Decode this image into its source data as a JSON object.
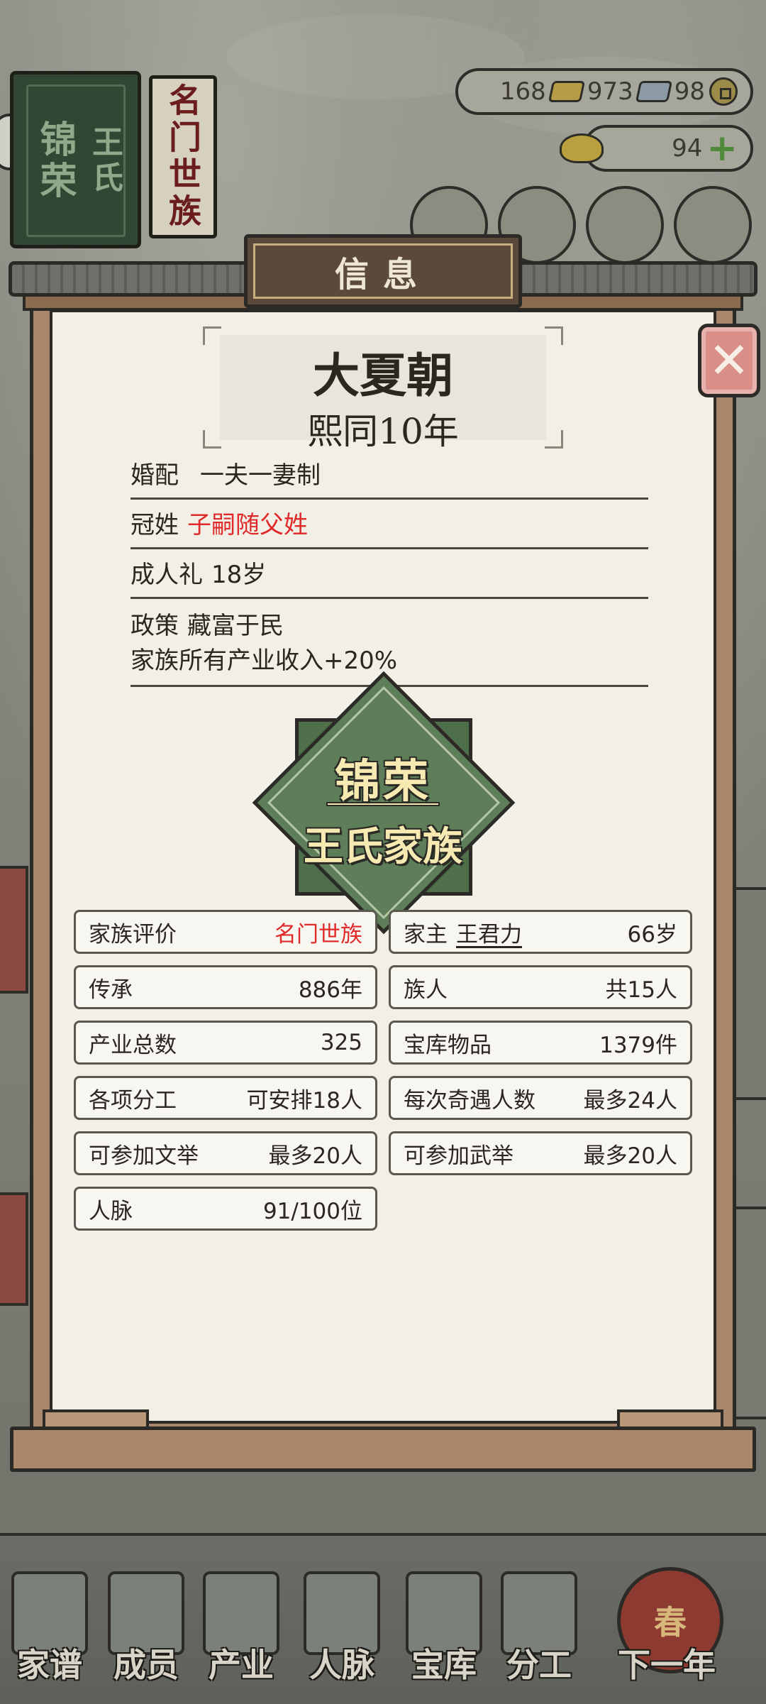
{
  "header": {
    "family_book": {
      "cover_title_1": "锦荣",
      "cover_title_2": "王氏",
      "rank_label": "名门世族"
    },
    "resources": {
      "gold": "168",
      "silver": "973",
      "coins": "98",
      "yuanbao": "94"
    }
  },
  "modal": {
    "title": "信息",
    "close_icon": "close-x-icon",
    "dynasty": "大夏朝",
    "reign_year": "熙同10年",
    "rules": [
      {
        "key": "婚配",
        "value": "一夫一妻制"
      },
      {
        "key": "冠姓",
        "value": "子嗣随父姓"
      },
      {
        "key": "成人礼",
        "value": "18岁"
      },
      {
        "key": "政策",
        "value": "藏富于民",
        "detail": "家族所有产业收入+20%"
      }
    ],
    "emblem": {
      "line1": "锦荣",
      "line2": "王氏家族"
    },
    "stats": {
      "rating_label": "家族评价",
      "rating_value": "名门世族",
      "head_label": "家主",
      "head_name": "王君力",
      "head_age": "66岁",
      "legacy_label": "传承",
      "legacy_value": "886年",
      "members_label": "族人",
      "members_value": "共15人",
      "industry_label": "产业总数",
      "industry_value": "325",
      "treasury_label": "宝库物品",
      "treasury_value": "1379件",
      "division_label": "各项分工",
      "division_value": "可安排18人",
      "encounter_label": "每次奇遇人数",
      "encounter_value": "最多24人",
      "civil_exam_label": "可参加文举",
      "civil_exam_value": "最多20人",
      "military_exam_label": "可参加武举",
      "military_exam_value": "最多20人",
      "network_label": "人脉",
      "network_value": "91/100位"
    }
  },
  "bottom_nav": {
    "genealogy": "家谱",
    "members": "成员",
    "industry": "产业",
    "network": "人脉",
    "treasury": "宝库",
    "division": "分工",
    "next_year": "下一年",
    "next_year_badge": "春"
  },
  "colors": {
    "accent_red": "#e02a2a",
    "emblem_green": "#5d7e58",
    "paper": "#f1efe6",
    "frame_wood": "#a9876a"
  }
}
